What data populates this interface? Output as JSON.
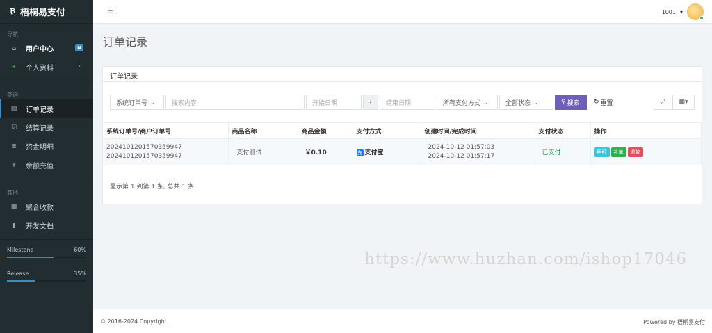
{
  "brand": {
    "name": "梧桐易支付"
  },
  "sidebar": {
    "section_nav": "导航",
    "section_query": "查询",
    "section_other": "其他",
    "items": [
      {
        "label": "用户中心",
        "icon": "home-icon",
        "badge": "N"
      },
      {
        "label": "个人资料",
        "icon": "leaf-icon"
      },
      {
        "label": "订单记录",
        "icon": "list-icon"
      },
      {
        "label": "结算记录",
        "icon": "check-square-icon"
      },
      {
        "label": "资金明细",
        "icon": "bars-icon"
      },
      {
        "label": "余额充值",
        "icon": "yen-icon"
      },
      {
        "label": "聚合收款",
        "icon": "qrcode-icon"
      },
      {
        "label": "开发文档",
        "icon": "book-icon"
      }
    ],
    "progress": [
      {
        "label": "Milestone",
        "percent": "60%",
        "value": 0.6
      },
      {
        "label": "Release",
        "percent": "35%",
        "value": 0.35
      }
    ]
  },
  "header": {
    "username": "1001"
  },
  "main": {
    "page_title": "订单记录",
    "panel_title": "订单记录",
    "filters": {
      "order_type": "系统订单号",
      "search_placeholder": "搜索内容",
      "start_placeholder": "开始日期",
      "end_placeholder": "结束日期",
      "pay_method": "所有支付方式",
      "status": "全部状态",
      "search_label": "搜索",
      "reset_label": "重置"
    },
    "table": {
      "headers": [
        "系统订单号/商户订单号",
        "商品名称",
        "商品金额",
        "支付方式",
        "创建时间/完成时间",
        "支付状态",
        "操作"
      ],
      "rows": [
        {
          "order_no": "2024101201570359947",
          "merchant_no": "2024101201570359947",
          "product": "支付测试",
          "amount": "￥0.10",
          "pay_method": "支付宝",
          "created": "2024-10-12 01:57:03",
          "finished": "2024-10-12 01:57:17",
          "status": "已支付",
          "op_detail": "明细",
          "op_bu": "补单",
          "op_refund": "退款"
        }
      ]
    },
    "summary": "显示第 1 到第 1 条, 总共 1 条"
  },
  "watermark": "https://www.huzhan.com/ishop17046",
  "footer": {
    "copyright": "© 2016-2024 Copyright.",
    "powered": "Powered by 梧桐易支付"
  },
  "colors": {
    "sidebar": "#222d32",
    "accent": "#3c8dbc",
    "search_btn": "#6f5fb8",
    "paid": "#1f8f3a"
  }
}
